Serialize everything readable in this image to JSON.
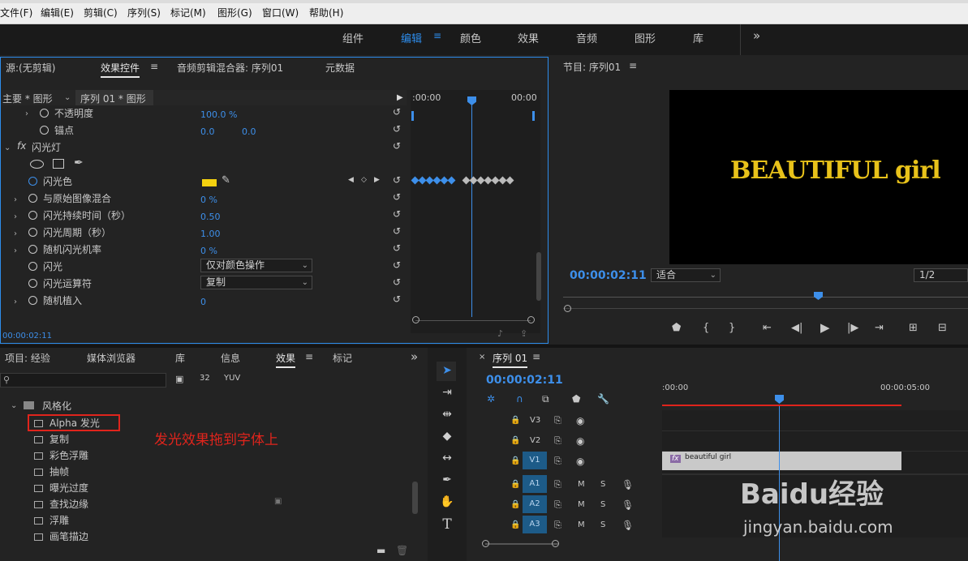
{
  "menu": [
    "文件(F)",
    "编辑(E)",
    "剪辑(C)",
    "序列(S)",
    "标记(M)",
    "图形(G)",
    "窗口(W)",
    "帮助(H)"
  ],
  "workspaces": [
    "组件",
    "编辑",
    "颜色",
    "效果",
    "音频",
    "图形",
    "库"
  ],
  "workspace_active": "编辑",
  "workspace_more": "»",
  "source_panel": {
    "tabs": [
      "源:(无剪辑)",
      "效果控件",
      "音频剪辑混合器: 序列01",
      "元数据"
    ],
    "menu_icon": "≡",
    "breadcrumb_left": "主要 * 图形",
    "breadcrumb_right": "序列 01 * 图形",
    "tl_start": ":00:00",
    "tl_end": "00:00",
    "rows": [
      {
        "label": "不透明度",
        "values": [
          "100.0 %"
        ]
      },
      {
        "label": "锚点",
        "values": [
          "0.0",
          "0.0"
        ]
      },
      {
        "label": "闪光灯",
        "fx": "fx"
      },
      {
        "label": "闪光色",
        "values": []
      },
      {
        "label": "与原始图像混合",
        "values": [
          "0 %"
        ]
      },
      {
        "label": "闪光持续时间（秒）",
        "values": [
          "0.50"
        ]
      },
      {
        "label": "闪光周期（秒）",
        "values": [
          "1.00"
        ]
      },
      {
        "label": "随机闪光机率",
        "values": [
          "0 %"
        ]
      },
      {
        "label": "闪光",
        "dropdown": "仅对颜色操作"
      },
      {
        "label": "闪光运算符",
        "dropdown": "复制"
      },
      {
        "label": "随机植入",
        "values": [
          "0"
        ]
      }
    ],
    "flash_color": "#f4d10f",
    "timecode": "00:00:02:11"
  },
  "program": {
    "title": "节目: 序列01",
    "menu_icon": "≡",
    "overlay_text": "BEAUTIFUL  girl",
    "timecode": "00:00:02:11",
    "fit": "适合",
    "ratio": "1/2",
    "text_color": "#e8c21a"
  },
  "project_panel": {
    "tabs": [
      "项目: 经验",
      "媒体浏览器",
      "库",
      "信息",
      "效果",
      "标记"
    ],
    "more": "»",
    "menu_icon": "≡",
    "search_placeholder": "",
    "folder": "风格化",
    "items": [
      "Alpha 发光",
      "复制",
      "彩色浮雕",
      "抽帧",
      "曝光过度",
      "查找边缘",
      "浮雕",
      "画笔描边"
    ],
    "annotation": "发光效果拖到字体上",
    "highlight_color": "#e0241c"
  },
  "sequence": {
    "title": "序列 01",
    "menu_icon": "≡",
    "timecode": "00:00:02:11",
    "ruler_start": ":00:00",
    "ruler_end": "00:00:05:00",
    "video_tracks": [
      "V3",
      "V2",
      "V1"
    ],
    "audio_tracks": [
      "A1",
      "A2",
      "A3"
    ],
    "audio_buttons": [
      "M",
      "S"
    ],
    "clip_label": "beautiful  girl",
    "clip_fx": "fx"
  },
  "watermark": {
    "brand": "Baidu经验",
    "url": "jingyan.baidu.com"
  }
}
